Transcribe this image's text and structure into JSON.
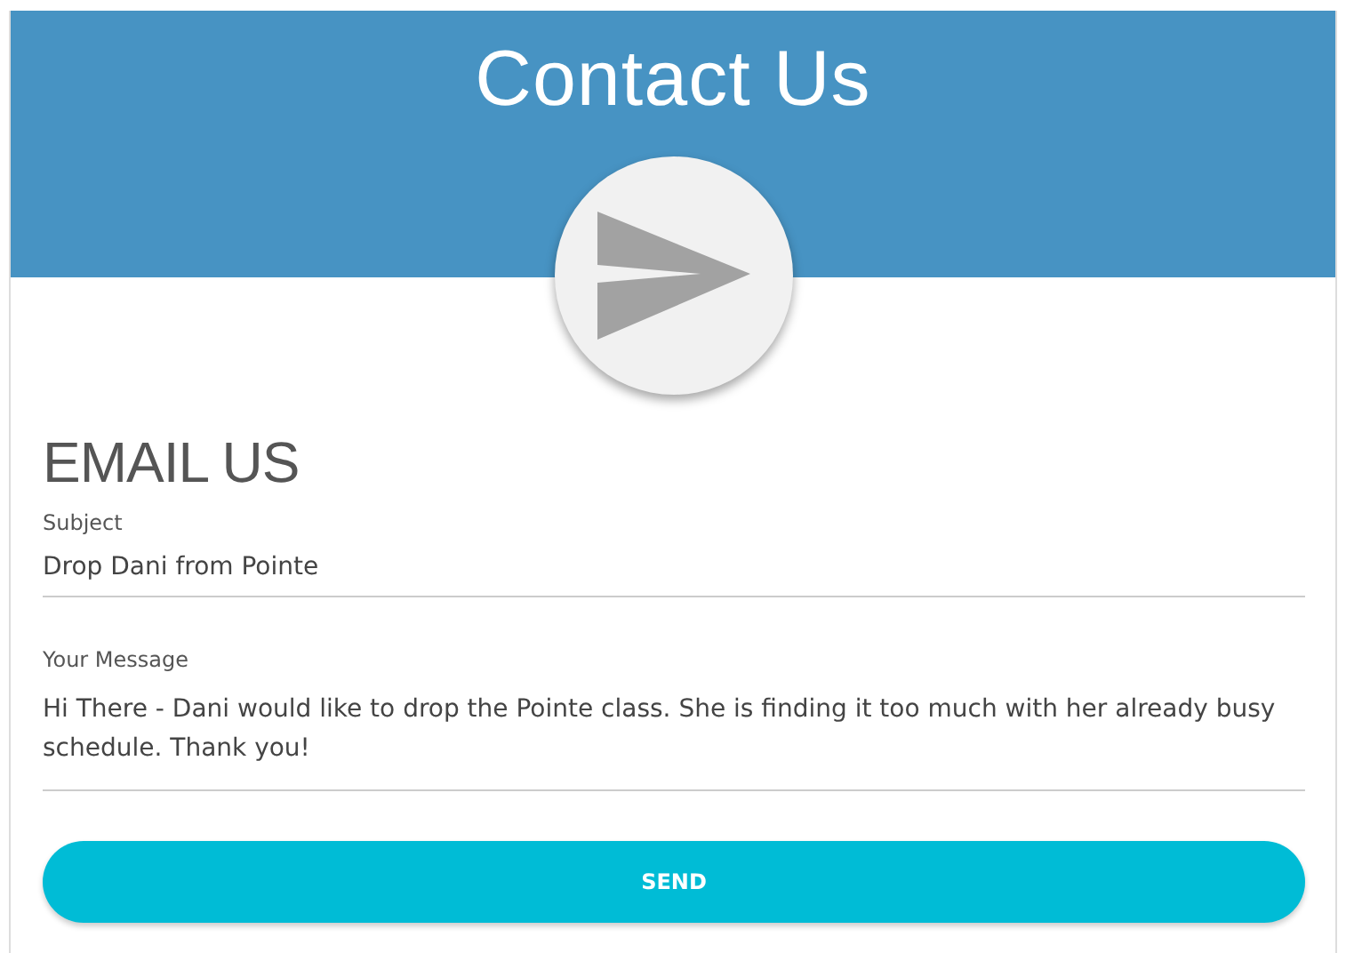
{
  "header": {
    "title": "Contact Us"
  },
  "form": {
    "heading": "EMAIL US",
    "fields": [
      {
        "kind": "line",
        "label": "Subject",
        "value": "Drop Dani from Pointe"
      },
      {
        "kind": "area",
        "label": "Your Message",
        "value": "Hi There - Dani would like to drop the Pointe class. She is finding it too much with her already busy schedule. Thank you!"
      }
    ],
    "submit": "SEND"
  }
}
